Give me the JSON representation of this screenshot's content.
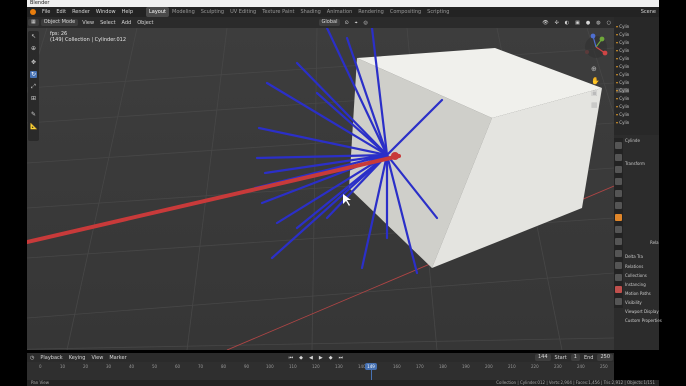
{
  "window": {
    "title": "Blender"
  },
  "menu": {
    "items": [
      "File",
      "Edit",
      "Render",
      "Window",
      "Help"
    ],
    "workspaces": [
      "Layout",
      "Modeling",
      "Sculpting",
      "UV Editing",
      "Texture Paint",
      "Shading",
      "Animation",
      "Rendering",
      "Compositing",
      "Scripting"
    ],
    "active_workspace": "Layout",
    "scene": "Scene"
  },
  "viewport_header": {
    "mode": "Object Mode",
    "menus": [
      "View",
      "Select",
      "Add",
      "Object"
    ],
    "orientation": "Global"
  },
  "overlay_info": {
    "fps": "fps: 26",
    "collection": "(149) Collection | Cylinder.012"
  },
  "outliner": {
    "rows": [
      "Cylin",
      "Cylin",
      "Cylin",
      "Cylin",
      "Cylin",
      "Cylin",
      "Cylin",
      "Cylin",
      "Cylin",
      "Cylin",
      "Cylin",
      "Cylin",
      "Cylin"
    ]
  },
  "properties": {
    "object_name": "Cylinde",
    "sections": [
      "Transform",
      "Relations",
      "Collections",
      "Instancing",
      "Motion Paths",
      "Visibility",
      "Viewport Display",
      "Custom Properties"
    ],
    "short_labels": [
      "Rela",
      "Delta Tra"
    ]
  },
  "timeline": {
    "menus": [
      "Playback",
      "Keying",
      "View",
      "Marker"
    ],
    "current_frame": "144",
    "start_label": "Start",
    "start": "1",
    "end_label": "End",
    "end": "250",
    "ticks": [
      "0",
      "10",
      "20",
      "30",
      "40",
      "50",
      "60",
      "70",
      "80",
      "90",
      "100",
      "110",
      "120",
      "130",
      "140",
      "150",
      "160",
      "170",
      "180",
      "190",
      "200",
      "210",
      "220",
      "230",
      "240",
      "250"
    ],
    "playhead": "149"
  },
  "statusbar": {
    "left": "Pan View",
    "right": "Collection | Cylinder.012 | Verts:2,904 | Faces:1,456 | Tris:2,912 | Objects:1/151"
  },
  "colors": {
    "accent": "#4772b3",
    "blue_rod": "#2b2fc8",
    "red_rod": "#c83a3a",
    "cube": "#e6e6e2"
  }
}
